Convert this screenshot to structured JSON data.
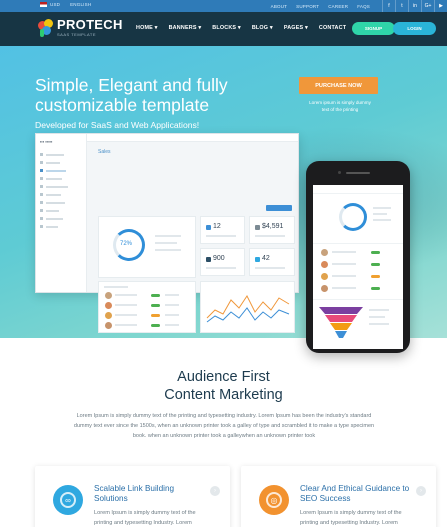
{
  "topbar": {
    "currency": "USD",
    "language": "ENGLISH",
    "links": [
      "ABOUT",
      "SUPPORT",
      "CAREER",
      "FAQS"
    ],
    "social_icons": [
      "facebook-icon",
      "twitter-icon",
      "linkedin-icon",
      "google-plus-icon",
      "youtube-icon"
    ],
    "social_glyphs": [
      "f",
      "t",
      "in",
      "G+",
      "▶"
    ]
  },
  "nav": {
    "brand": "PROTECH",
    "brand_sub": "SAAS TEMPLATE",
    "menu": [
      "HOME ▾",
      "BANNERS ▾",
      "BLOCKS ▾",
      "BLOG ▾",
      "PAGES ▾",
      "CONTACT"
    ],
    "signup": "SIGNUP",
    "login": "LOGIN"
  },
  "hero": {
    "title": "Simple, Elegant and fully customizable template",
    "subtitle": "Developed for SaaS and Web Applications!",
    "purchase": "PURCHASE NOW",
    "purchase_note": "Lorem ipsum is simply dummy text of the printing"
  },
  "dashboard": {
    "title": "Sales",
    "ring_value": "72%",
    "stats": [
      "12",
      "$4,591",
      "900",
      "42"
    ]
  },
  "section": {
    "title": "Audience First Content Marketing",
    "text": "Lorem Ipsum is simply dummy text of the printing and typesetting industry. Lorem Ipsum has been the industry's standard dummy text ever since the 1500s, when an unknown printer took a galley of type and scrambled it to make a type specimen book. when an unknown printer took a galleywhen an unknown printer took"
  },
  "features": [
    {
      "title": "Scalable Link Building Solutions",
      "text": "Lorem Ipsum is simply dummy text of the printing and typesetting Industry. Lorem",
      "color": "#2fa8e0",
      "icon": "link-icon",
      "glyph": "∞"
    },
    {
      "title": "Clear And Ethical Guidance to SEO Success",
      "text": "Lorem Ipsum is simply dummy text of the printing and typesetting Industry. Lorem",
      "color": "#f2922f",
      "icon": "target-icon",
      "glyph": "◎"
    }
  ],
  "colors": {
    "nav_bg": "#173544",
    "topbar_bg": "#2f7bb8",
    "accent_orange": "#f0973a",
    "accent_green": "#2fd5a9",
    "accent_blue": "#2ab4d8"
  }
}
